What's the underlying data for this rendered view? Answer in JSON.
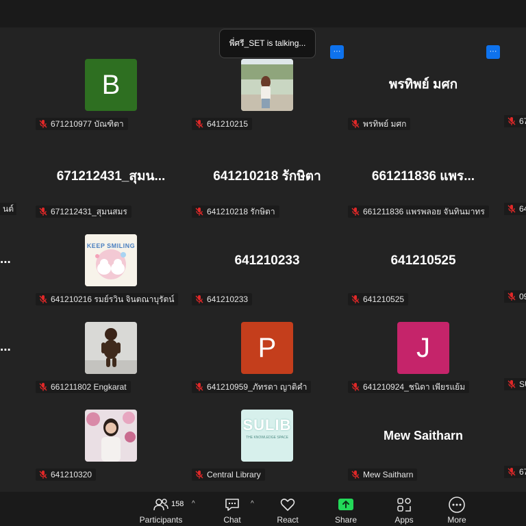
{
  "toast": {
    "text": "พี่ศรี_SET is talking..."
  },
  "tile_menu_label": "···",
  "participants": [
    {
      "id": "r1c1",
      "display": "B",
      "name": "671210977 บัณฑิตา",
      "avatar": "letter",
      "color": "#2e6f21"
    },
    {
      "id": "r1c2",
      "display": "",
      "name": "641210215",
      "avatar": "photo-outdoor"
    },
    {
      "id": "r1c3",
      "display": "พรทิพย์ มศก",
      "name": "พรทิพย์ มศก",
      "avatar": "text"
    },
    {
      "id": "r2c1",
      "display": "671212431_สุมน...",
      "name": "671212431_สุมนสมร",
      "avatar": "text"
    },
    {
      "id": "r2c2",
      "display": "641210218 รักษิตา",
      "name": "641210218 รักษิตา",
      "avatar": "text"
    },
    {
      "id": "r2c3",
      "display": "661211836 แพร...",
      "name": "661211836 แพรพลอย จันทินมาทร",
      "avatar": "text"
    },
    {
      "id": "r3c1",
      "display": "",
      "name": "641210216 รมย์รวิน จินตณาบุรัตน์",
      "avatar": "photo-keep-smiling",
      "badge_text": "KEEP SMILING"
    },
    {
      "id": "r3c2",
      "display": "641210233",
      "name": "641210233",
      "avatar": "text"
    },
    {
      "id": "r3c3",
      "display": "641210525",
      "name": "641210525",
      "avatar": "text"
    },
    {
      "id": "r4c1",
      "display": "",
      "name": "661211802 Engkarat",
      "avatar": "photo-dancing"
    },
    {
      "id": "r4c2",
      "display": "P",
      "name": "641210959_ภัทรดา ญาติคำ",
      "avatar": "letter",
      "color": "#c43e1c"
    },
    {
      "id": "r4c3",
      "display": "J",
      "name": "641210924_ชนิดา เพียรแย้ม",
      "avatar": "letter",
      "color": "#c5246a"
    },
    {
      "id": "r5c1",
      "display": "",
      "name": "641210320",
      "avatar": "photo-person"
    },
    {
      "id": "r5c2",
      "display": "",
      "name": "Central Library",
      "avatar": "photo-sulib",
      "badge_text": "SULIB",
      "badge_sub": "THE KNOWLEDGE SPACE"
    },
    {
      "id": "r5c3",
      "display": "Mew Saitharn",
      "name": "Mew Saitharn",
      "avatar": "text"
    }
  ],
  "edge_left": {
    "row2": "นต์",
    "row3_dots": "...",
    "row4_dots": "..."
  },
  "edge_right": {
    "row1": "67",
    "row2": "64",
    "row3": "09",
    "row4": "SU",
    "row5": "67"
  },
  "toolbar": {
    "participants_count": "158",
    "participants": "Participants",
    "chat": "Chat",
    "react": "React",
    "share": "Share",
    "apps": "Apps",
    "more": "More",
    "caret": "^"
  },
  "colors": {
    "accent": "#0e72ed",
    "share": "#23d959",
    "mic_muted": "#e02828"
  }
}
